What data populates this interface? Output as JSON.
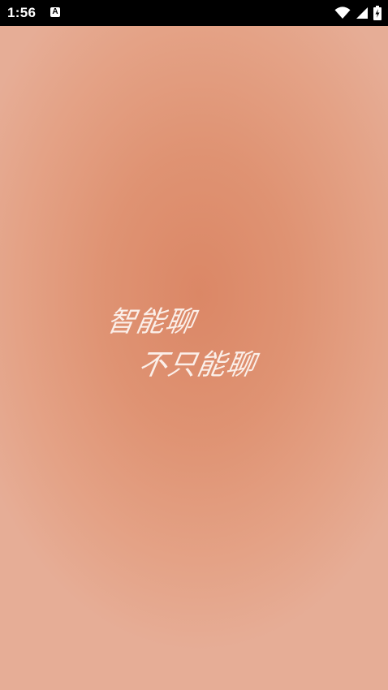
{
  "status_bar": {
    "time": "1:56",
    "notification_glyph": "A",
    "icons": [
      "wifi-icon",
      "cellular-signal-icon",
      "battery-charging-icon"
    ]
  },
  "splash": {
    "slogan_line1": "智能聊",
    "slogan_line2": "不只能聊"
  },
  "colors": {
    "status_bar_bg": "#000000",
    "background_center": "#db8766",
    "background_edge": "#e6ad96",
    "text": "#fbefe9"
  }
}
